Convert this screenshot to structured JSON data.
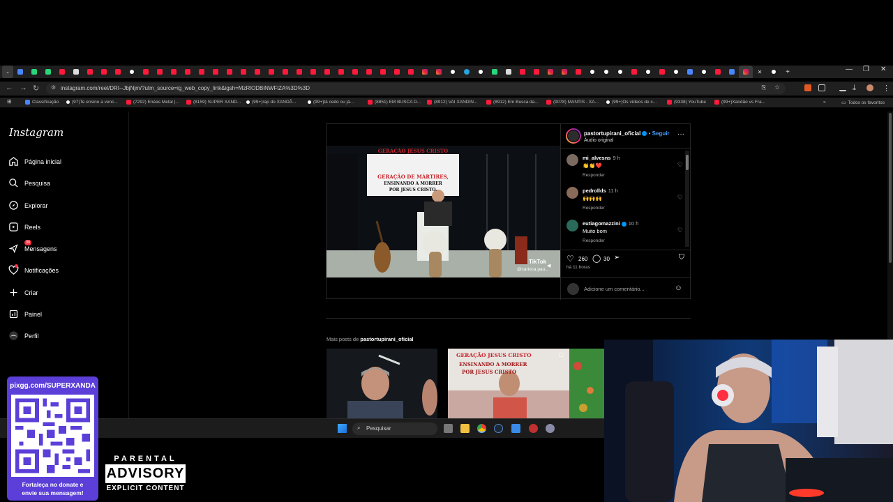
{
  "browser": {
    "url": "instagram.com/reel/DRI--JbjNjm/?utm_source=ig_web_copy_link&igsh=MzRlODBiNWFlZA%3D%3D",
    "bookmarks": [
      "Classificação",
      "(97)Te ensino a venc...",
      "(7292) Enéas Metal |...",
      "(8159) SUPER XAND...",
      "(99+)rap do XANDÃ...",
      "(99+)tá cedo ou já...",
      "(8851) EM BUSCA D...",
      "(8912) VAI XANDIN...",
      "(8912) Em Busca da...",
      "(9078) MANTIS - XA...",
      "(99+)Os vídeos de c...",
      "(9338) YouTube",
      "(99+)Xandão vs Fra..."
    ],
    "all_bookmarks": "Todos os favoritos"
  },
  "sidebar": {
    "logo": "Instagram",
    "items": [
      {
        "label": "Página inicial",
        "icon": "home-icon"
      },
      {
        "label": "Pesquisa",
        "icon": "search-icon"
      },
      {
        "label": "Explorar",
        "icon": "compass-icon"
      },
      {
        "label": "Reels",
        "icon": "reels-icon"
      },
      {
        "label": "Mensagens",
        "icon": "messenger-icon",
        "badge": "30"
      },
      {
        "label": "Notificações",
        "icon": "heart-icon"
      },
      {
        "label": "Criar",
        "icon": "plus-icon"
      },
      {
        "label": "Painel",
        "icon": "dashboard-icon"
      },
      {
        "label": "Perfil",
        "icon": "profile-avatar"
      }
    ]
  },
  "video": {
    "banner_line1": "GERAÇÃO JESUS CRISTO",
    "banner_line2": "GERAÇÃO DE MÁRTIRES,",
    "banner_line3": "ENSINANDO A MORRER",
    "banner_line4": "POR JESUS CRISTO.",
    "watermark": "TikTok",
    "watermark_handle": "@carioca.pau..."
  },
  "post": {
    "author": "pastortupirani_oficial",
    "follow": "Seguir",
    "audio": "Áudio original",
    "comments": [
      {
        "user": "mi_alvesns",
        "time": "9 h",
        "text": "👏👏❤️",
        "reply": "Responder"
      },
      {
        "user": "pedrollds",
        "time": "11 h",
        "text": "🙌🙌🙌",
        "reply": "Responder"
      },
      {
        "user": "eutiagomazzini",
        "time": "10 h",
        "text": "Muito bom",
        "reply": "Responder",
        "verified": true
      }
    ],
    "likes": "260",
    "comment_count": "30",
    "posted": "há 11 horas",
    "comment_placeholder": "Adicione um comentário..."
  },
  "more_posts": {
    "label": "Mais posts de",
    "author": "pastortupirani_oficial",
    "thumb2_text1": "GERAÇÃO JESUS CRISTO",
    "thumb2_text2": "ENSINANDO A MORRER",
    "thumb2_text3": "POR JESUS CRISTO"
  },
  "taskbar": {
    "search_placeholder": "Pesquisar"
  },
  "overlay": {
    "pix_url": "pixgg.com/SUPERXANDA",
    "pix_caption_1": "Fortaleça no donate e",
    "pix_caption_2": "envie sua mensagem!",
    "advisory_1": "PARENTAL",
    "advisory_2": "ADVISORY",
    "advisory_3": "EXPLICIT CONTENT"
  },
  "colors": {
    "background": "#000000",
    "link_blue": "#0095f6",
    "notification_red": "#ff3040",
    "qr_card_purple": "#5b3fd8"
  }
}
